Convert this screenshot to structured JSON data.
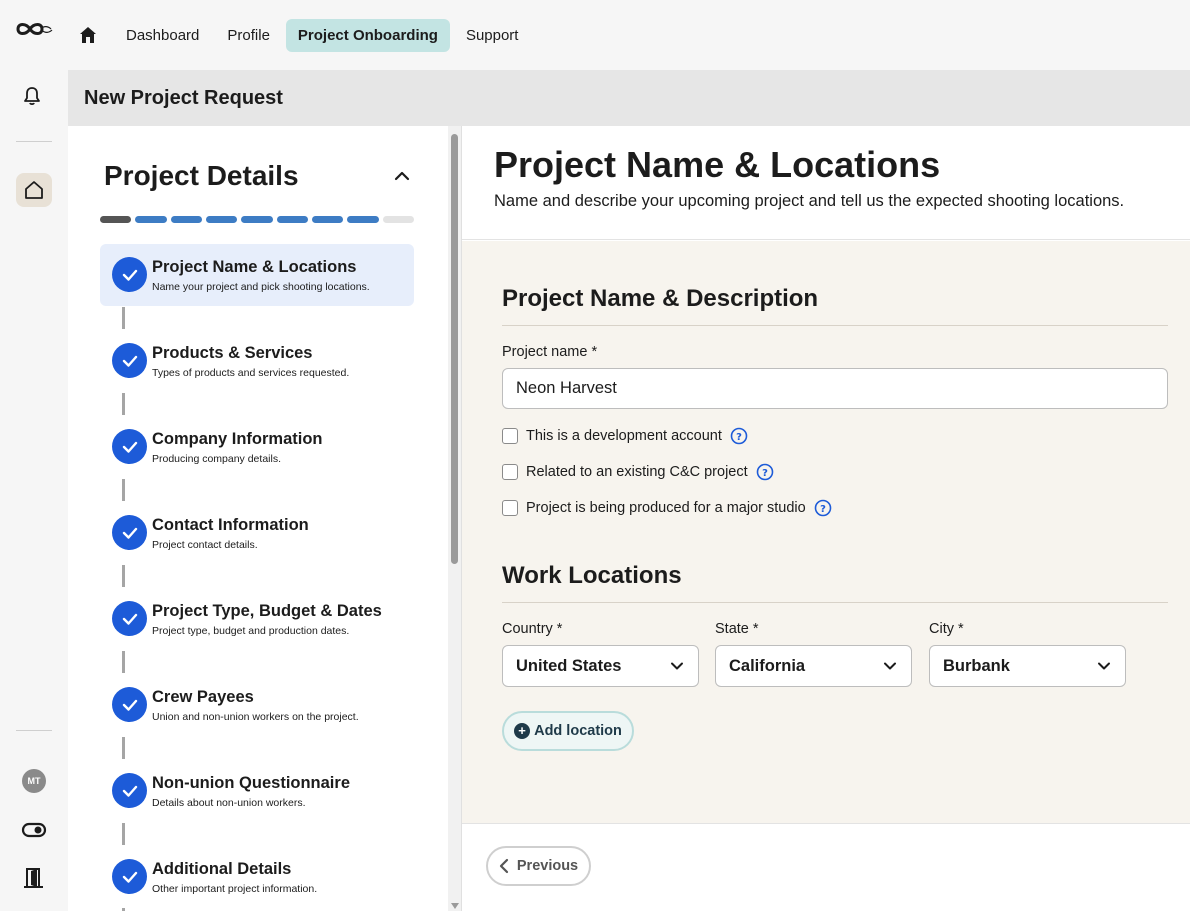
{
  "nav": {
    "items": [
      {
        "label": "Dashboard"
      },
      {
        "label": "Profile"
      },
      {
        "label": "Project Onboarding",
        "active": true
      },
      {
        "label": "Support"
      }
    ]
  },
  "rail": {
    "avatar_initials": "MT",
    "icons": [
      "brand-logo",
      "bell-icon",
      "home-icon",
      "toggle-icon",
      "exit-door-icon"
    ]
  },
  "page": {
    "title": "New Project Request"
  },
  "steps": {
    "title": "Project Details",
    "progress": {
      "completed": 7,
      "total": 9
    },
    "items": [
      {
        "title": "Project Name & Locations",
        "subtitle": "Name your project and pick shooting locations.",
        "active": true
      },
      {
        "title": "Products & Services",
        "subtitle": "Types of products and services requested."
      },
      {
        "title": "Company Information",
        "subtitle": "Producing company details."
      },
      {
        "title": "Contact Information",
        "subtitle": "Project contact details."
      },
      {
        "title": "Project Type, Budget & Dates",
        "subtitle": "Project type, budget and production dates."
      },
      {
        "title": "Crew Payees",
        "subtitle": "Union and non-union workers on the project."
      },
      {
        "title": "Non-union Questionnaire",
        "subtitle": "Details about non-union workers."
      },
      {
        "title": "Additional Details",
        "subtitle": "Other important project information."
      }
    ]
  },
  "main": {
    "title": "Project Name & Locations",
    "subtitle": "Name and describe your upcoming project and tell us the expected shooting locations.",
    "section1": {
      "title": "Project Name & Description",
      "project_name_label": "Project name *",
      "project_name_value": "Neon Harvest",
      "checkboxes": [
        {
          "label": "This is a development account",
          "checked": false
        },
        {
          "label": "Related to an existing C&C project",
          "checked": false
        },
        {
          "label": "Project is being produced for a major studio",
          "checked": false
        }
      ]
    },
    "section2": {
      "title": "Work Locations",
      "country_label": "Country *",
      "country_value": "United States",
      "state_label": "State *",
      "state_value": "California",
      "city_label": "City *",
      "city_value": "Burbank",
      "add_location_label": "Add location"
    },
    "footer": {
      "previous_label": "Previous"
    }
  },
  "colors": {
    "accent_teal": "#c3e4e3",
    "step_check": "#1d5bd8",
    "progress_blue": "#3d7cc4",
    "active_step_bg": "#e7eefb",
    "form_bg": "#f7f4ee"
  }
}
